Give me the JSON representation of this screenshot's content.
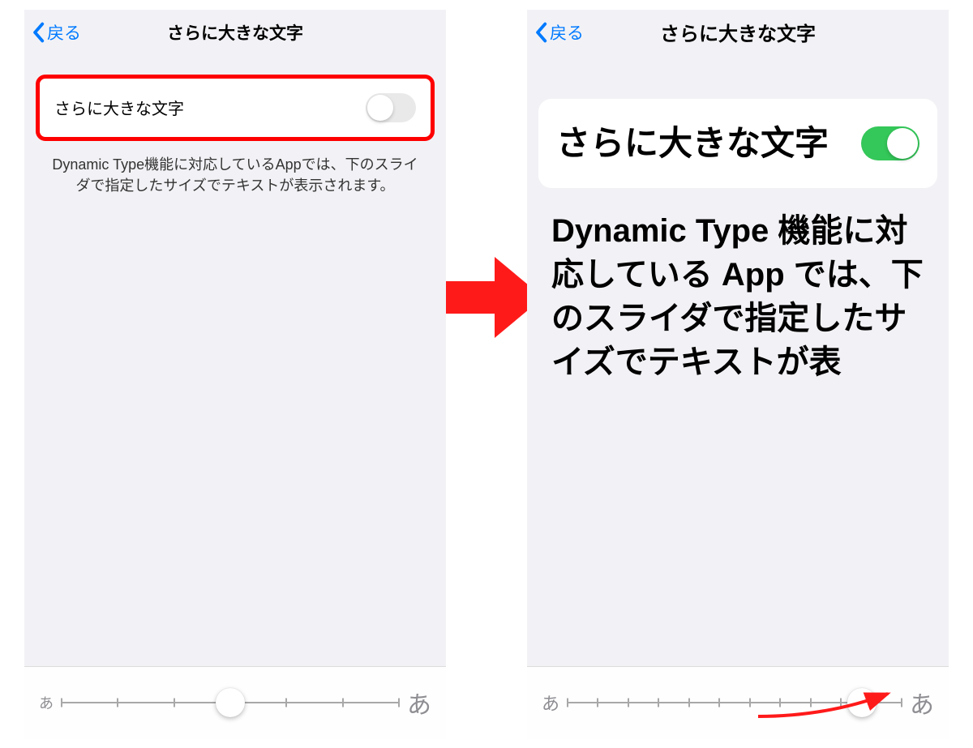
{
  "left": {
    "back": "戻る",
    "title": "さらに大きな文字",
    "card_label": "さらに大きな文字",
    "toggle_on": false,
    "description": "Dynamic Type機能に対応しているAppでは、下のスライダで指定したサイズでテキストが表示されます。",
    "slider": {
      "left_char": "あ",
      "right_char": "あ",
      "ticks": 7,
      "thumb_position_percent": 50
    }
  },
  "right": {
    "back": "戻る",
    "title": "さらに大きな文字",
    "card_label": "さらに大きな文字",
    "toggle_on": true,
    "description": "Dynamic Type 機能に対応している App では、下のスライダで指定したサイズでテキストが表",
    "slider": {
      "left_char": "あ",
      "right_char": "あ",
      "ticks": 12,
      "thumb_position_percent": 88
    }
  }
}
